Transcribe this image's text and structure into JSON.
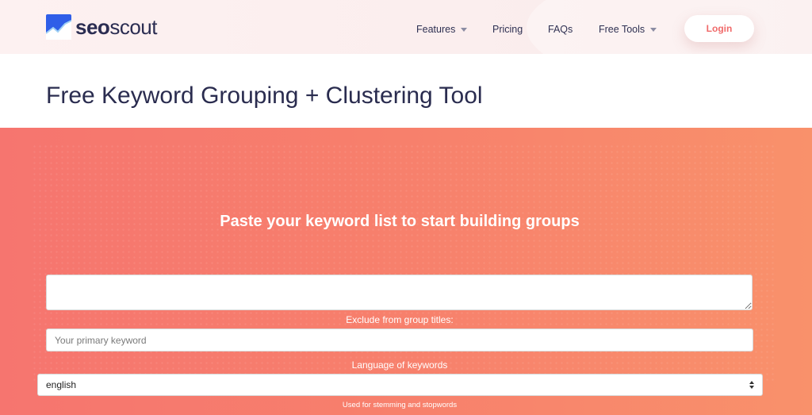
{
  "brand": {
    "name_bold": "seo",
    "name_light": "scout"
  },
  "nav": {
    "items": [
      {
        "label": "Features",
        "has_dropdown": true
      },
      {
        "label": "Pricing",
        "has_dropdown": false
      },
      {
        "label": "FAQs",
        "has_dropdown": false
      },
      {
        "label": "Free Tools",
        "has_dropdown": true
      }
    ],
    "login_label": "Login"
  },
  "page": {
    "title": "Free Keyword Grouping + Clustering Tool"
  },
  "hero": {
    "heading": "Paste your keyword list to start building groups",
    "keywords_value": "",
    "exclude_label": "Exclude from group titles:",
    "primary_keyword_placeholder": "Your primary keyword",
    "language_label": "Language of keywords",
    "language_selected": "english",
    "language_help": "Used for stemming and stopwords"
  },
  "colors": {
    "accent": "#f06a6a",
    "hero_start": "#f6756f",
    "hero_end": "#f9916b",
    "text_dark": "#2a2c4f"
  }
}
